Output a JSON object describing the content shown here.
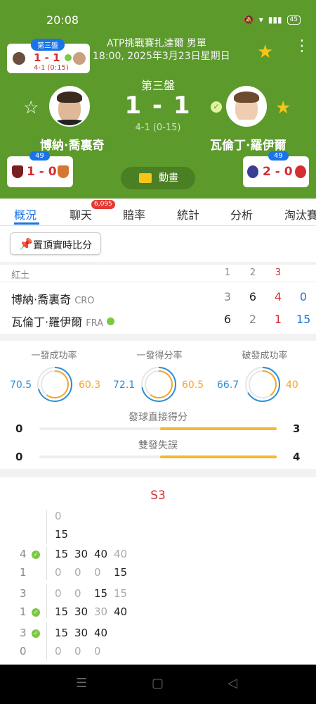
{
  "status": {
    "time": "20:08",
    "battery": "45"
  },
  "mini": {
    "badge": "第三盤",
    "score": "1 - 1",
    "sub": "4-1 (0:15)"
  },
  "league": {
    "title": "ATP挑戰賽扎達爾 男單",
    "datetime": "18:00, 2025年3月23日星期日"
  },
  "match": {
    "set_label": "第三盤",
    "score": "1 - 1",
    "game_score": "4-1 (0-15)"
  },
  "players": {
    "home": {
      "name": "博納·喬裏奇",
      "h2h_badge": "49",
      "h2h_score": "1 - 0"
    },
    "away": {
      "name": "瓦倫丁·羅伊爾",
      "h2h_badge": "49",
      "h2h_score": "2 - 0"
    }
  },
  "animation_label": "動畫",
  "tabs": [
    "概況",
    "聊天",
    "賠率",
    "統計",
    "分析",
    "淘汰賽"
  ],
  "chat_count": "6,095",
  "pin_label": "置頂實時比分",
  "score_table": {
    "surface": "紅土",
    "set_headers": [
      "1",
      "2",
      "3"
    ],
    "rows": [
      {
        "name": "博納·喬裏奇",
        "country": "CRO",
        "sets": [
          "3",
          "6",
          "4"
        ],
        "points": "0"
      },
      {
        "name": "瓦倫丁·羅伊爾",
        "country": "FRA",
        "sets": [
          "6",
          "2",
          "1"
        ],
        "points": "15"
      }
    ]
  },
  "stats": {
    "gauges": [
      {
        "label": "一發成功率",
        "home": "70.5",
        "away": "60.3",
        "home_frac": 0.705,
        "away_frac": 0.603
      },
      {
        "label": "一發得分率",
        "home": "72.1",
        "away": "60.5",
        "home_frac": 0.721,
        "away_frac": 0.605
      },
      {
        "label": "破發成功率",
        "home": "66.7",
        "away": "40",
        "home_frac": 0.667,
        "away_frac": 0.4
      }
    ],
    "bars": [
      {
        "label": "發球直接得分",
        "home": "0",
        "away": "3"
      },
      {
        "label": "雙發失誤",
        "home": "0",
        "away": "4"
      }
    ]
  },
  "pbp": {
    "set_label": "S3",
    "current": {
      "top": "0",
      "bottom": "15"
    },
    "games": [
      {
        "home_games": "4",
        "away_games": "1",
        "top": [
          "15",
          "30",
          "40",
          "40"
        ],
        "bottom": [
          "0",
          "0",
          "0",
          "15"
        ]
      },
      {
        "home_games": "3",
        "away_games": "1",
        "top": [
          "0",
          "0",
          "15",
          "15"
        ],
        "bottom": [
          "15",
          "30",
          "30",
          "40"
        ]
      },
      {
        "home_games": "3",
        "away_games": "0",
        "top": [
          "15",
          "30",
          "40"
        ],
        "bottom": [
          "0",
          "0",
          "0"
        ]
      }
    ]
  },
  "colors": {
    "header_bg": "#5c9a2c",
    "accent": "#1a73e8",
    "score_red": "#d32f2f",
    "gold": "#f5c518",
    "home_series": "#2b8fd6",
    "away_series": "#f5a623"
  }
}
